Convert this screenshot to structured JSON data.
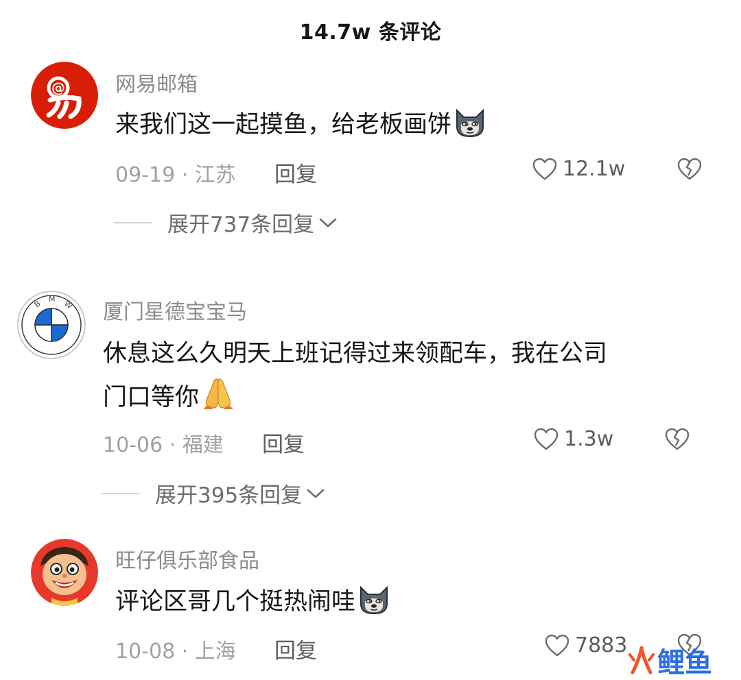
{
  "header": {
    "title": "14.7w 条评论"
  },
  "comments": [
    {
      "username": "网易邮箱",
      "avatar_icon": "netease-mail-logo",
      "avatar_text": "@易",
      "content_lines": [
        "来我们这一起摸鱼，给老板画饼"
      ],
      "emoji": "doge-icon",
      "meta": "09-19 · 江苏",
      "reply_label": "回复",
      "like_count": "12.1w",
      "expand_text": "展开737条回复"
    },
    {
      "username": "厦门星德宝宝马",
      "avatar_icon": "bmw-logo",
      "avatar_text": "BMW",
      "content_lines": [
        "休息这么久明天上班记得过来领配车，我在公司",
        "门口等你"
      ],
      "emoji": "praying-hands-icon",
      "meta": "10-06 · 福建",
      "reply_label": "回复",
      "like_count": "1.3w",
      "expand_text": "展开395条回复"
    },
    {
      "username": "旺仔俱乐部食品",
      "avatar_icon": "wangzai-mascot",
      "content_lines": [
        "评论区哥几个挺热闹哇"
      ],
      "emoji": "doge-icon",
      "meta": "10-08 · 上海",
      "reply_label": "回复",
      "like_count": "7883"
    }
  ],
  "watermark": {
    "logo_icon": "fire-icon",
    "text": "鲤鱼"
  },
  "colors": {
    "netease_red": "#d81e06",
    "bmw_blue": "#1c69d4",
    "watermark_orange": "#f2542d",
    "watermark_blue": "#2a6fe3"
  }
}
